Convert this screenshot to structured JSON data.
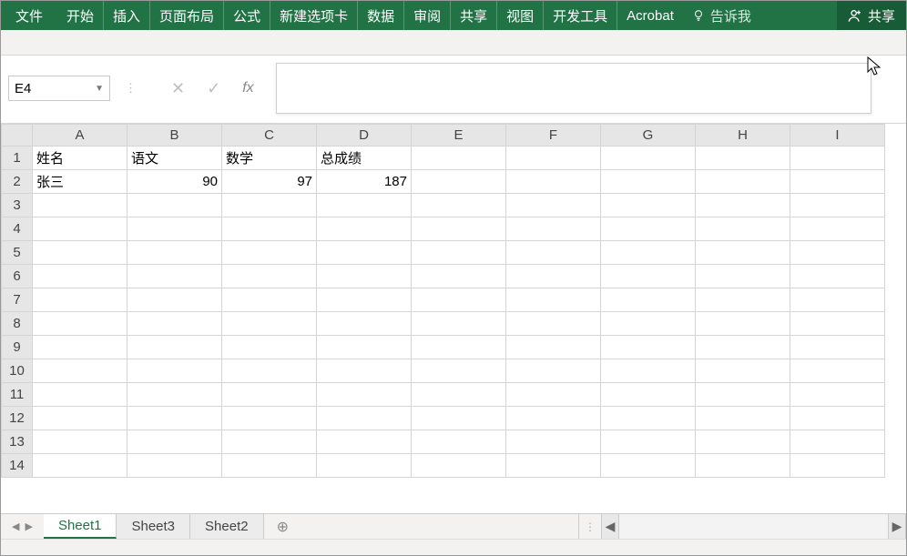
{
  "ribbon": {
    "file": "文件",
    "tabs": [
      "开始",
      "插入",
      "页面布局",
      "公式",
      "新建选项卡",
      "数据",
      "审阅",
      "共享",
      "视图",
      "开发工具",
      "Acrobat"
    ],
    "tellme": "告诉我",
    "share": "共享"
  },
  "formula_bar": {
    "name_box": "E4",
    "formula": ""
  },
  "columns": [
    "A",
    "B",
    "C",
    "D",
    "E",
    "F",
    "G",
    "H",
    "I"
  ],
  "rows": [
    "1",
    "2",
    "3",
    "4",
    "5",
    "6",
    "7",
    "8",
    "9",
    "10",
    "11",
    "12",
    "13",
    "14"
  ],
  "cells": {
    "A1": "姓名",
    "B1": "语文",
    "C1": "数学",
    "D1": "总成绩",
    "A2": "张三",
    "B2": "90",
    "C2": "97",
    "D2": "187"
  },
  "chart_data": {
    "type": "table",
    "headers": [
      "姓名",
      "语文",
      "数学",
      "总成绩"
    ],
    "rows": [
      {
        "姓名": "张三",
        "语文": 90,
        "数学": 97,
        "总成绩": 187
      }
    ]
  },
  "sheets": {
    "tabs": [
      "Sheet1",
      "Sheet3",
      "Sheet2"
    ],
    "active_index": 0
  }
}
